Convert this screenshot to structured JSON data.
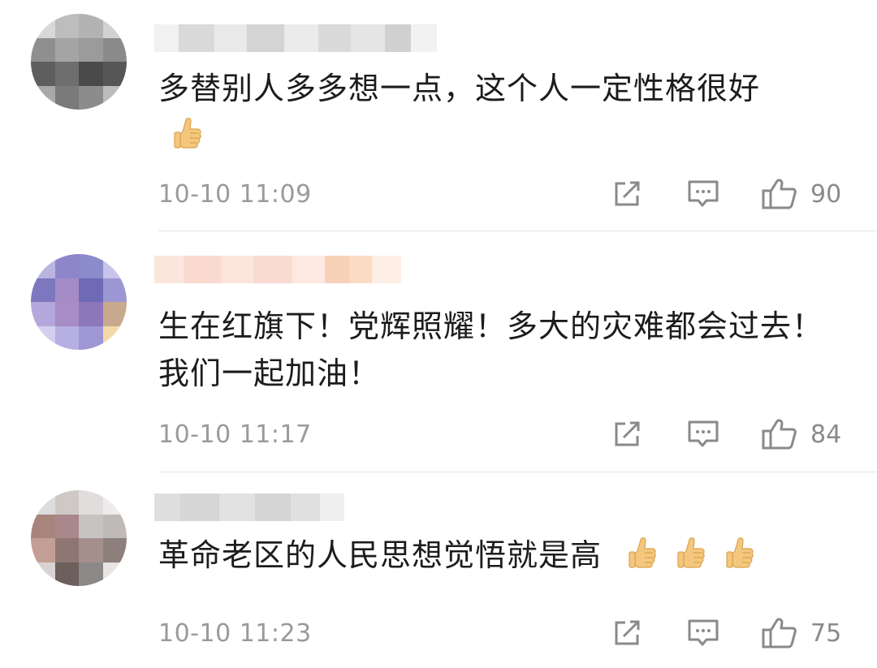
{
  "comments": [
    {
      "text": "多替别人多多想一点，这个人一定性格很好",
      "time": "10-10 11:09",
      "likes": "90",
      "thumbs": 1
    },
    {
      "text": "生在红旗下！党辉照耀！多大的灾难都会过去！我们一起加油！",
      "time": "10-10 11:17",
      "likes": "84",
      "thumbs": 0
    },
    {
      "text": "革命老区的人民思想觉悟就是高",
      "time": "10-10 11:23",
      "likes": "75",
      "thumbs": 3
    }
  ],
  "icons": {
    "share": "share-icon",
    "reply": "comment-icon",
    "like": "thumbs-up-icon",
    "emoji": "thumbs-up-emoji-icon"
  },
  "colors": {
    "text": "#1c1c1c",
    "meta": "#9a9a9a",
    "icon": "#8a8a8a",
    "divider": "#e6e6e6"
  }
}
